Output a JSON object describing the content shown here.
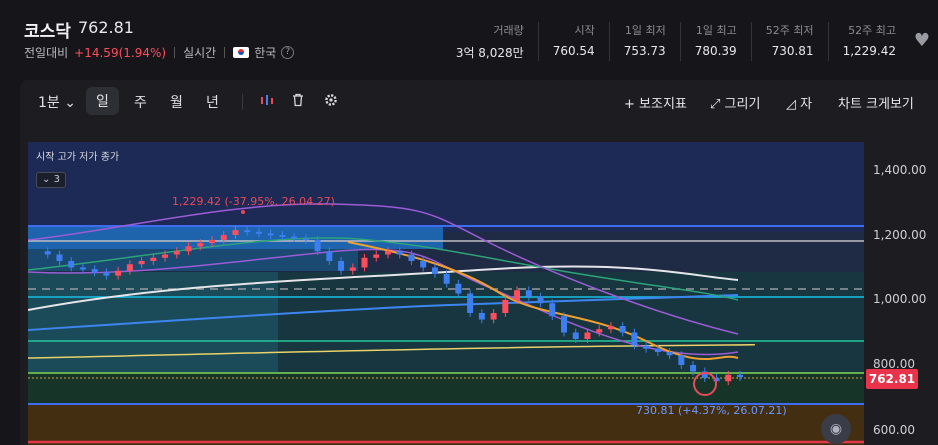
{
  "header": {
    "title": "코스닥",
    "price": "762.81",
    "change_label": "전일대비",
    "change": "+14.59(1.94%)",
    "realtime": "실시간",
    "country": "한국",
    "help": "?"
  },
  "stats": [
    {
      "label": "거래량",
      "value": "3억 8,028만"
    },
    {
      "label": "시작",
      "value": "760.54"
    },
    {
      "label": "1일 최저",
      "value": "753.73"
    },
    {
      "label": "1일 최고",
      "value": "780.39"
    },
    {
      "label": "52주 최저",
      "value": "730.81"
    },
    {
      "label": "52주 최고",
      "value": "1,229.42"
    }
  ],
  "toolbar": {
    "interval": "1분",
    "periods": [
      "일",
      "주",
      "월",
      "년"
    ],
    "indicator": "+ 보조지표",
    "draw": "⤢ 그리기",
    "ruler": "◿ 자",
    "size": "차트 크게보기"
  },
  "chart": {
    "legend": "시작 고가 저가 종가",
    "collapse": "⌄ 3",
    "yticks": [
      "1,400.00",
      "1,200.00",
      "1,000.00",
      "800.00",
      "600.00"
    ],
    "current_price": "762.81",
    "annotation_high": "1,229.42 (-37.95%, 26.04.27)",
    "annotation_low": "730.81 (+4.37%, 26.07.21)"
  },
  "colors": {
    "up": "#ff4d5e",
    "down": "#3d7ff0",
    "accent": "#e8334a"
  },
  "chart_data": {
    "type": "candlestick",
    "ylim": [
      600,
      1400
    ],
    "yticks": [
      1400,
      1200,
      1000,
      800,
      600
    ],
    "high": {
      "value": 1229.42,
      "label": "1,229.42 (-37.95%, 26.04.27)"
    },
    "low": {
      "value": 730.81,
      "label": "730.81 (+4.37%, 26.07.21)"
    },
    "last": 762.81,
    "closes": [
      1150,
      1140,
      1120,
      1100,
      1095,
      1085,
      1075,
      1090,
      1110,
      1120,
      1130,
      1140,
      1150,
      1165,
      1175,
      1185,
      1200,
      1215,
      1210,
      1205,
      1200,
      1195,
      1190,
      1185,
      1150,
      1120,
      1090,
      1100,
      1130,
      1140,
      1150,
      1140,
      1120,
      1100,
      1080,
      1050,
      1020,
      960,
      940,
      960,
      1000,
      1030,
      1010,
      990,
      950,
      900,
      880,
      900,
      910,
      920,
      900,
      860,
      850,
      840,
      830,
      800,
      780,
      760,
      750,
      770,
      762.81
    ]
  }
}
